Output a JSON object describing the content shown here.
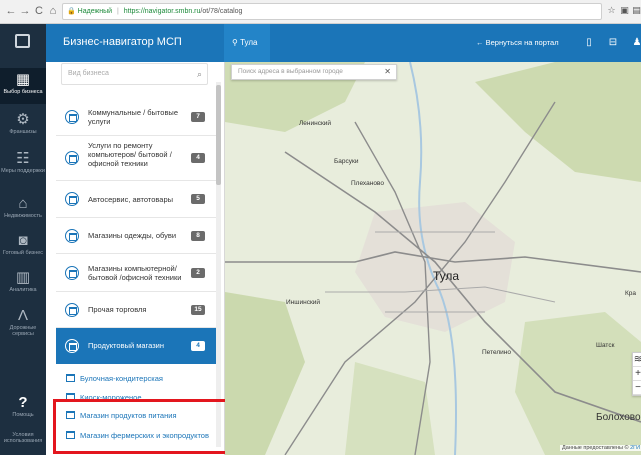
{
  "browser": {
    "nav": [
      "←",
      "→",
      "C",
      "⌂"
    ],
    "secure_label": "Надежный",
    "url_host": "https://navigator.smbn.ru",
    "url_path": "/ot/78/catalog",
    "icons": [
      "star-icon",
      "extension-icon",
      "profile-icon"
    ]
  },
  "rail": {
    "items": [
      {
        "label": "Выбор бизнеса",
        "icon": "ⓘ",
        "active": true
      },
      {
        "label": "Франшизы",
        "icon": "⚙"
      },
      {
        "label": "Меры поддержки",
        "icon": "♨"
      },
      {
        "label": "Недвижимость",
        "icon": "⌂"
      },
      {
        "label": "Готовый бизнес",
        "icon": "⊕"
      },
      {
        "label": "Аналитика",
        "icon": "▥"
      },
      {
        "label": "Дорожные сервисы",
        "icon": "⩘"
      },
      {
        "label": "Помощь",
        "icon": "?"
      },
      {
        "label": "Условия использования",
        "icon": ""
      }
    ]
  },
  "header": {
    "title": "Бизнес-навигатор МСП",
    "city": "Тула",
    "back_label": "Вернуться на портал"
  },
  "panel": {
    "search_placeholder": "Вид бизнеса",
    "categories": [
      {
        "label": "Коммунальные / бытовые услуги",
        "count": "7"
      },
      {
        "label": "Услуги по ремонту компьютеров/ бытовой / офисной техники",
        "count": "4"
      },
      {
        "label": "Автосервис, автотовары",
        "count": "5"
      },
      {
        "label": "Магазины одежды, обуви",
        "count": "8"
      },
      {
        "label": "Магазины компьютерной/ бытовой /офисной техники",
        "count": "2"
      },
      {
        "label": "Прочая торговля",
        "count": "15"
      },
      {
        "label": "Продуктовый магазин",
        "count": "4",
        "active": true
      }
    ],
    "subitems": [
      "Булочная-кондитерская",
      "Киоск-мороженое",
      "Магазин продуктов питания",
      "Магазин фермерских и экопродуктов"
    ]
  },
  "map": {
    "search_placeholder": "Поиск адреса в выбранном городе",
    "city_label": "Тула",
    "places": [
      "Ленинский",
      "Барсуки",
      "Плеханово",
      "Иншинский",
      "Петелино",
      "Шатск",
      "Болохово",
      "Кра"
    ],
    "credits_prefix": "Данные предоставлены ©",
    "credits_link": "2ГИ",
    "zoom": [
      "+",
      "−"
    ]
  }
}
